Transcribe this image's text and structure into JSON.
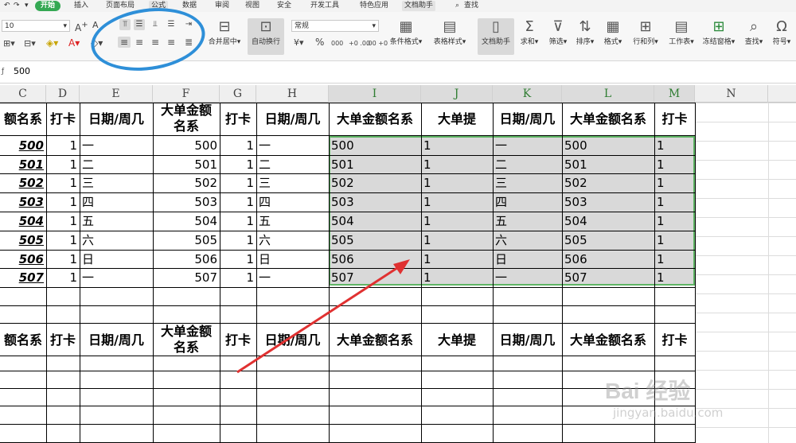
{
  "menu": {
    "items": [
      {
        "label": "开始",
        "active": true
      },
      {
        "label": "插入"
      },
      {
        "label": "页面布局"
      },
      {
        "label": "公式",
        "tool": true
      },
      {
        "label": "数据"
      },
      {
        "label": "审阅"
      },
      {
        "label": "视图"
      },
      {
        "label": "安全"
      },
      {
        "label": "开发工具"
      },
      {
        "label": "特色应用"
      },
      {
        "label": "文档助手",
        "tool": true
      },
      {
        "label": "查找"
      }
    ]
  },
  "ribbon": {
    "font_size": "10",
    "number_format": "常规",
    "merge_center": "合并居中",
    "wrap_text": "自动换行",
    "conditional_format": "条件格式",
    "table_style": "表格样式",
    "doc_helper": "文档助手",
    "sum": "求和",
    "filter": "筛选",
    "sort": "排序",
    "format": "格式",
    "row_col": "行和列",
    "worksheet": "工作表",
    "freeze": "冻结窗格",
    "find": "查找",
    "symbol": "符号",
    "percent": "%",
    "thousands": "000",
    "dec_inc": "+0 .00",
    "dec_dec": ".00 +0"
  },
  "formula_bar": {
    "value": "500"
  },
  "columns": [
    "C",
    "D",
    "E",
    "F",
    "G",
    "H",
    "I",
    "J",
    "K",
    "L",
    "M",
    "N"
  ],
  "table1": {
    "headers": [
      "额名系",
      "打卡",
      "日期/周几",
      "大单金额名系",
      "打卡",
      "日期/周几",
      "大单金额名系",
      "大单提",
      "日期/周几",
      "大单金额名系",
      "打卡"
    ],
    "header_f_line1": "大单金额",
    "header_f_line2": "名系",
    "rows": [
      [
        "500",
        "1",
        "一",
        "500",
        "1",
        "一",
        "500",
        "1",
        "一",
        "500",
        "1"
      ],
      [
        "501",
        "1",
        "二",
        "501",
        "1",
        "二",
        "501",
        "1",
        "二",
        "501",
        "1"
      ],
      [
        "502",
        "1",
        "三",
        "502",
        "1",
        "三",
        "502",
        "1",
        "三",
        "502",
        "1"
      ],
      [
        "503",
        "1",
        "四",
        "503",
        "1",
        "四",
        "503",
        "1",
        "四",
        "503",
        "1"
      ],
      [
        "504",
        "1",
        "五",
        "504",
        "1",
        "五",
        "504",
        "1",
        "五",
        "504",
        "1"
      ],
      [
        "505",
        "1",
        "六",
        "505",
        "1",
        "六",
        "505",
        "1",
        "六",
        "505",
        "1"
      ],
      [
        "506",
        "1",
        "日",
        "506",
        "1",
        "日",
        "506",
        "1",
        "日",
        "506",
        "1"
      ],
      [
        "507",
        "1",
        "一",
        "507",
        "1",
        "一",
        "507",
        "1",
        "一",
        "507",
        "1"
      ]
    ]
  },
  "table2": {
    "headers": [
      "额名系",
      "打卡",
      "日期/周几",
      "大单金额名系",
      "打卡",
      "日期/周几",
      "大单金额名系",
      "大单提",
      "日期/周几",
      "大单金额名系",
      "打卡"
    ],
    "header_f_line1": "大单金额",
    "header_f_line2": "名系"
  },
  "watermark": {
    "line1": "Bai 经验",
    "line2": "jingyan.baidu.com"
  },
  "colors": {
    "accent": "#34a853",
    "selection_border": "#5fb565",
    "annotation": "#2e8fd8",
    "arrow": "#e03131"
  }
}
